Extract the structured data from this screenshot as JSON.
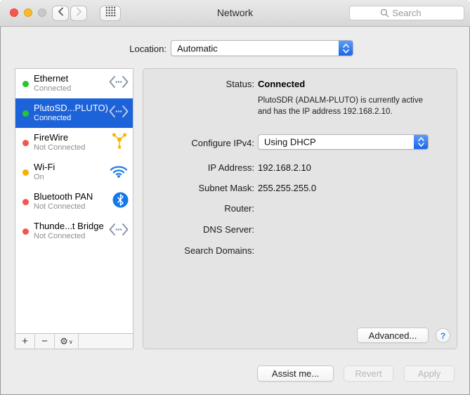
{
  "titlebar": {
    "title": "Network",
    "search_placeholder": "Search"
  },
  "location": {
    "label": "Location:",
    "value": "Automatic"
  },
  "sidebar": {
    "items": [
      {
        "name": "Ethernet",
        "status": "Connected",
        "dot": "green",
        "icon": "ethernet-icon",
        "selected": false
      },
      {
        "name": "PlutoSD...PLUTO)",
        "status": "Connected",
        "dot": "green",
        "icon": "ethernet-icon",
        "selected": true
      },
      {
        "name": "FireWire",
        "status": "Not Connected",
        "dot": "red",
        "icon": "firewire-icon",
        "selected": false
      },
      {
        "name": "Wi-Fi",
        "status": "On",
        "dot": "yellow",
        "icon": "wifi-icon",
        "selected": false
      },
      {
        "name": "Bluetooth PAN",
        "status": "Not Connected",
        "dot": "red",
        "icon": "bluetooth-icon",
        "selected": false
      },
      {
        "name": "Thunde...t Bridge",
        "status": "Not Connected",
        "dot": "red",
        "icon": "ethernet-icon",
        "selected": false
      }
    ],
    "add_label": "+",
    "remove_label": "−",
    "gear_icon": "⚙",
    "gear_chevron": "∨"
  },
  "panel": {
    "status": {
      "label": "Status:",
      "value": "Connected",
      "desc_line1": "PlutoSDR (ADALM-PLUTO) is currently active",
      "desc_line2": "and has the IP address 192.168.2.10."
    },
    "fields": [
      {
        "label": "Configure IPv4:",
        "value": "Using DHCP"
      },
      {
        "label": "IP Address:",
        "value": "192.168.2.10"
      },
      {
        "label": "Subnet Mask:",
        "value": "255.255.255.0"
      },
      {
        "label": "Router:",
        "value": ""
      },
      {
        "label": "DNS Server:",
        "value": ""
      },
      {
        "label": "Search Domains:",
        "value": ""
      }
    ],
    "advanced_label": "Advanced...",
    "help_label": "?"
  },
  "footer": {
    "assist_label": "Assist me...",
    "revert_label": "Revert",
    "apply_label": "Apply"
  },
  "colors": {
    "selection": "#1c63d9",
    "dot_green": "#23c82c",
    "dot_red": "#f2564f",
    "dot_yellow": "#f5b200",
    "stepper_top": "#5a9bf8",
    "stepper_bottom": "#1d65e8",
    "help_blue": "#2e7bf6",
    "wifi_blue": "#1e7fe8",
    "bluetooth_blue": "#1479e8",
    "ethernet_gray": "#8593ab",
    "firewire_yellow": "#f2b800"
  }
}
